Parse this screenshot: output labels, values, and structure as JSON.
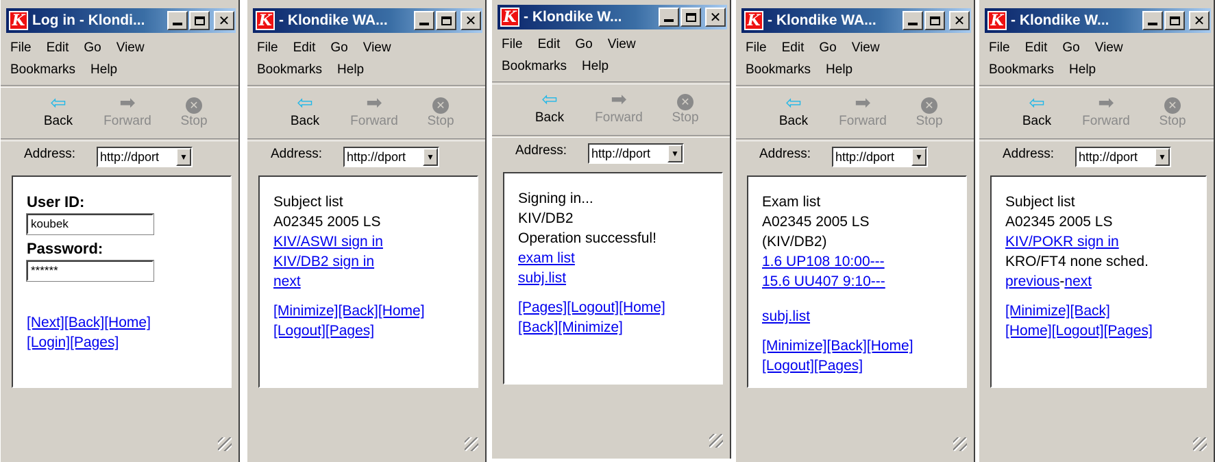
{
  "windows": [
    {
      "title": "Log in - Klondi...",
      "address": "http://dport",
      "content": {
        "user_id_label": "User ID:",
        "user_id_value": "koubek",
        "password_label": "Password:",
        "password_value": "******",
        "links_row1": [
          "[Next]",
          "[Back]",
          "[Home]"
        ],
        "links_row2": [
          "[Login]",
          "[Pages]"
        ]
      }
    },
    {
      "title": "- Klondike WA...",
      "address": "http://dport",
      "content": {
        "heading": "Subject list",
        "subheading": "A02345 2005 LS",
        "link1": "KIV/ASWI sign in",
        "link2": "KIV/DB2 sign in",
        "link3": "next",
        "links_row1": [
          "[Minimize]",
          "[Back]",
          "[Home]"
        ],
        "links_row2": [
          "[Logout]",
          "[Pages]"
        ]
      }
    },
    {
      "title": "- Klondike W...",
      "address": "http://dport",
      "content": {
        "line1": "Signing in...",
        "line2": "KIV/DB2",
        "line3": "Operation successful!",
        "link1": "exam list",
        "link2": "subj.list",
        "links_row1": [
          "[Pages]",
          "[Logout]",
          "[Home]"
        ],
        "links_row2": [
          "[Back]",
          "[Minimize]"
        ]
      }
    },
    {
      "title": "- Klondike WA...",
      "address": "http://dport",
      "content": {
        "line1": "Exam list",
        "line2": "A02345 2005 LS",
        "line3": "(KIV/DB2)",
        "link1": "1.6 UP108 10:00---",
        "link2": "15.6 UU407 9:10---",
        "link3": "subj.list",
        "links_row1": [
          "[Minimize]",
          "[Back]",
          "[Home]"
        ],
        "links_row2": [
          "[Logout]",
          "[Pages]"
        ]
      }
    },
    {
      "title": "- Klondike W...",
      "address": "http://dport",
      "content": {
        "heading": "Subject list",
        "subheading": "A02345 2005 LS",
        "link1": "KIV/POKR sign in",
        "line_static": "KRO/FT4 none sched.",
        "link_prev": "previous",
        "dash": "-",
        "link_next": "next",
        "links_row1": [
          "[Minimize]",
          "[Back]"
        ],
        "links_row2": [
          "[Home]",
          "[Logout]",
          "[Pages]"
        ]
      }
    }
  ],
  "chrome": {
    "app_icon_letter": "K",
    "menu_file": "File",
    "menu_edit": "Edit",
    "menu_go": "Go",
    "menu_view": "View",
    "menu_bookmarks": "Bookmarks",
    "menu_help": "Help",
    "back_label": "Back",
    "forward_label": "Forward",
    "stop_label": "Stop",
    "address_label": "Address:",
    "icons": {
      "back": "back-arrow-icon",
      "forward": "forward-arrow-icon",
      "stop": "stop-icon",
      "dropdown": "chevron-down-icon",
      "app": "klondike-app-icon",
      "resize": "resize-grip-icon"
    },
    "colors": {
      "titlebar": "#0a246a",
      "link": "#0000ee",
      "app_icon": "#ee1111",
      "back_arrow": "#22b8e8"
    }
  }
}
